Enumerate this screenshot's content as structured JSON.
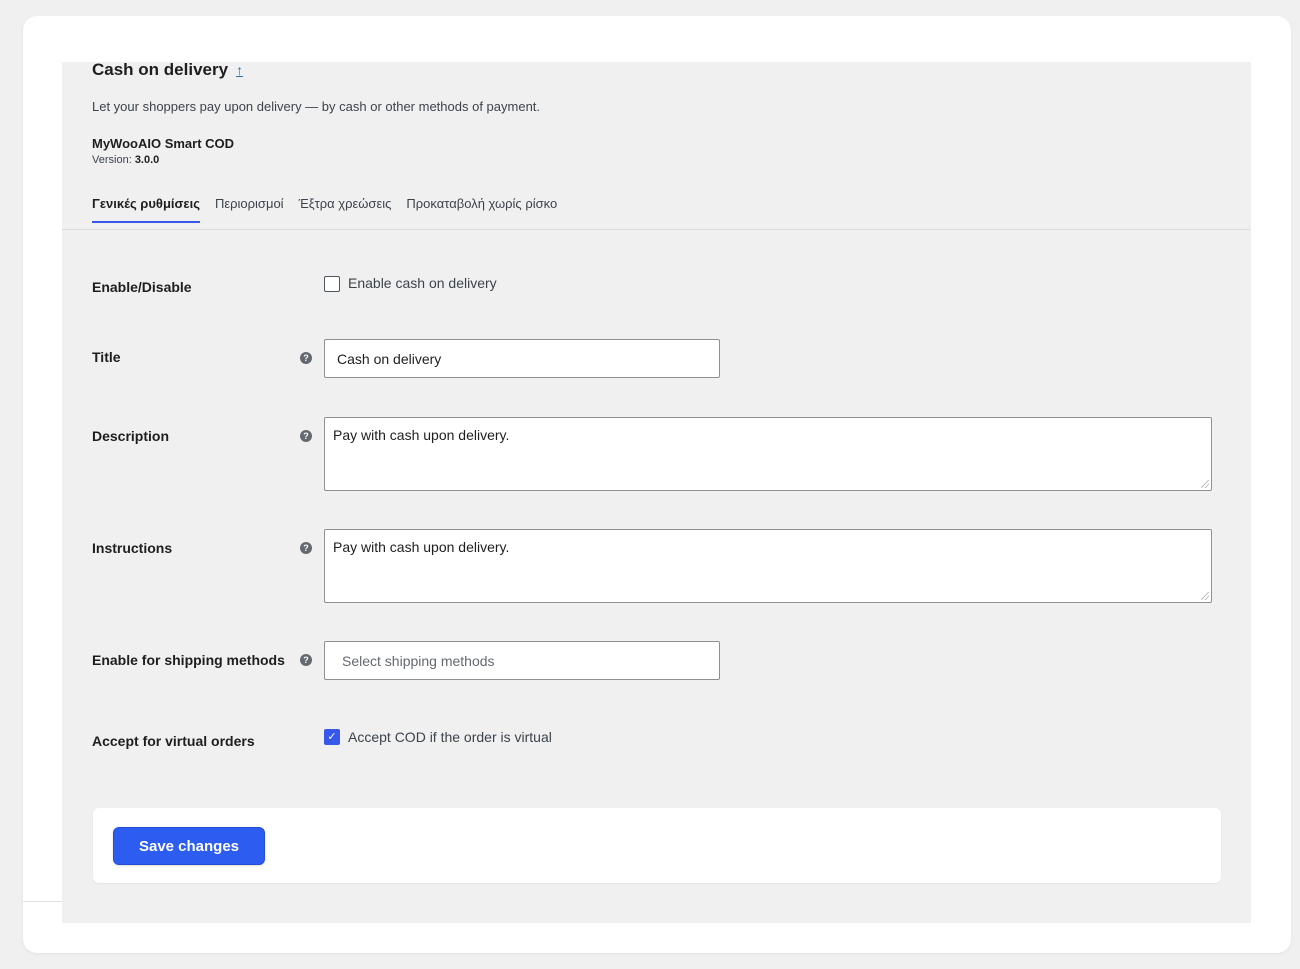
{
  "header": {
    "title": "Cash on delivery",
    "up_link": "↑",
    "description": "Let your shoppers pay upon delivery — by cash or other methods of payment.",
    "plugin_name": "MyWooAIO Smart COD",
    "version_label": "Version:",
    "version_value": "3.0.0"
  },
  "tabs": [
    {
      "label": "Γενικές ρυθμίσεις",
      "active": true
    },
    {
      "label": "Περιορισμοί",
      "active": false
    },
    {
      "label": "Έξτρα χρεώσεις",
      "active": false
    },
    {
      "label": "Προκαταβολή χωρίς ρίσκο",
      "active": false
    }
  ],
  "fields": {
    "enable": {
      "label": "Enable/Disable",
      "checkbox_label": "Enable cash on delivery",
      "checked": false
    },
    "title": {
      "label": "Title",
      "value": "Cash on delivery"
    },
    "description": {
      "label": "Description",
      "value": "Pay with cash upon delivery."
    },
    "instructions": {
      "label": "Instructions",
      "value": "Pay with cash upon delivery."
    },
    "shipping": {
      "label": "Enable for shipping methods",
      "placeholder": "Select shipping methods"
    },
    "virtual": {
      "label": "Accept for virtual orders",
      "checkbox_label": "Accept COD if the order is virtual",
      "checked": true
    }
  },
  "icons": {
    "help": "?",
    "check": "✓"
  },
  "footer": {
    "save_label": "Save changes"
  },
  "colors": {
    "accent": "#3858e9",
    "button": "#2c5cf0"
  }
}
